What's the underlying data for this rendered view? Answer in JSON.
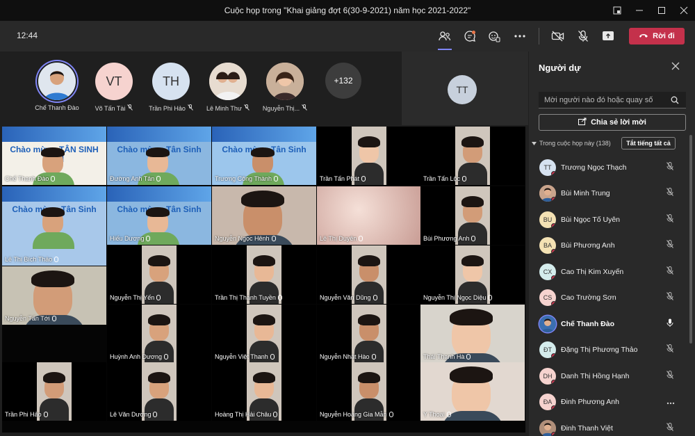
{
  "window": {
    "title": "Cuộc họp trong \"Khai giảng đợt 6(30-9-2021) năm học 2021-2022\""
  },
  "toolbar": {
    "clock": "12:44",
    "leave_label": "Rời đi"
  },
  "top_row": [
    {
      "name": "Chế Thanh Đào",
      "initials": "",
      "color": "#3b6fb0",
      "photo": true
    },
    {
      "name": "Võ Tấn Tài",
      "initials": "VT",
      "color": "#f6d3cf"
    },
    {
      "name": "Trần Phi Hảo",
      "initials": "TH",
      "color": "#d6e2f0"
    },
    {
      "name": "Lê Minh Thư",
      "initials": "",
      "color": "#c9b6a6",
      "photo": true
    },
    {
      "name": "Nguyễn Thị...",
      "initials": "",
      "color": "#d7b3a0",
      "photo": true
    }
  ],
  "overflow_count": "+132",
  "spotlight_initials": "TT",
  "tiles": [
    {
      "name": "Chế Thanh Đào",
      "banner": "Chào mừng TÂN SINH VIÊN"
    },
    {
      "name": "Đường Anh Tân",
      "banner": "Chào mừng Tân Sinh Viên"
    },
    {
      "name": "Trương Công Thành",
      "banner": "Chào mừng Tân Sinh Viên"
    },
    {
      "name": "Trần Tấn Phát"
    },
    {
      "name": "Trần Tấn Lộc"
    },
    {
      "name": "Lê Thị Bích Thảo",
      "banner": "Chào mừng Tân Sinh Viên"
    },
    {
      "name": "Hiếu Dương",
      "banner": "Chào mừng Tân Sinh Viên"
    },
    {
      "name": "Nguyễn Ngọc Hênh"
    },
    {
      "name": "Lê Thị Duyên"
    },
    {
      "name": "Bùi Phương Anh"
    },
    {
      "name": "Nguyễn Thị Yến"
    },
    {
      "name": "Trần Thị Thanh Tuyền"
    },
    {
      "name": "Nguyễn Văn Dũng"
    },
    {
      "name": "Nguyễn Thị Ngọc Diệu"
    },
    {
      "name": "Nguyễn Tấn Tới"
    },
    {
      "name": "Huỳnh Anh Dương"
    },
    {
      "name": "Nguyễn Việt Thanh"
    },
    {
      "name": "Nguyễn Nhật Hào"
    },
    {
      "name": "Thái Thanh Hà"
    },
    {
      "name": "Trần Phi Hảo"
    },
    {
      "name": "Lê Văn Dương"
    },
    {
      "name": "Hoàng Thị Hải Châu"
    },
    {
      "name": "Nguyễn Hoàng Gia Mẫn"
    },
    {
      "name": "Y Thoại"
    }
  ],
  "panel": {
    "title": "Người dự",
    "search_placeholder": "Mời người nào đó hoặc quay số",
    "share_label": "Chia sẻ lời mời",
    "section_label": "Trong cuộc họp này (138)",
    "mute_all_label": "Tắt tiếng tất cả",
    "participants": [
      {
        "name": "Trương Ngọc Thạch",
        "initials": "TT",
        "color": "#d6e2f0"
      },
      {
        "name": "Bùi Minh Trung",
        "initials": "",
        "color": "#c9a48c",
        "photo": true
      },
      {
        "name": "Bùi Ngọc Tố Uyên",
        "initials": "BU",
        "color": "#f4e2b4"
      },
      {
        "name": "Bùi Phương Anh",
        "initials": "BA",
        "color": "#f4e2b4"
      },
      {
        "name": "Cao Thị Kim Xuyến",
        "initials": "CX",
        "color": "#d4ecec"
      },
      {
        "name": "Cao Trường Sơn",
        "initials": "CS",
        "color": "#f6d3cf"
      },
      {
        "name": "Chế Thanh Đào",
        "initials": "",
        "color": "#3b6fb0",
        "photo": true,
        "speaking": true
      },
      {
        "name": "Đặng Thị Phương Thảo",
        "initials": "ĐT",
        "color": "#d4ecec"
      },
      {
        "name": "Danh Thị Hồng Hạnh",
        "initials": "DH",
        "color": "#f6d3cf"
      },
      {
        "name": "Đinh Phương Anh",
        "initials": "ĐA",
        "color": "#f6d3cf",
        "more": true
      },
      {
        "name": "Đinh Thanh Việt",
        "initials": "",
        "color": "#b08f7a",
        "photo": true
      }
    ]
  }
}
